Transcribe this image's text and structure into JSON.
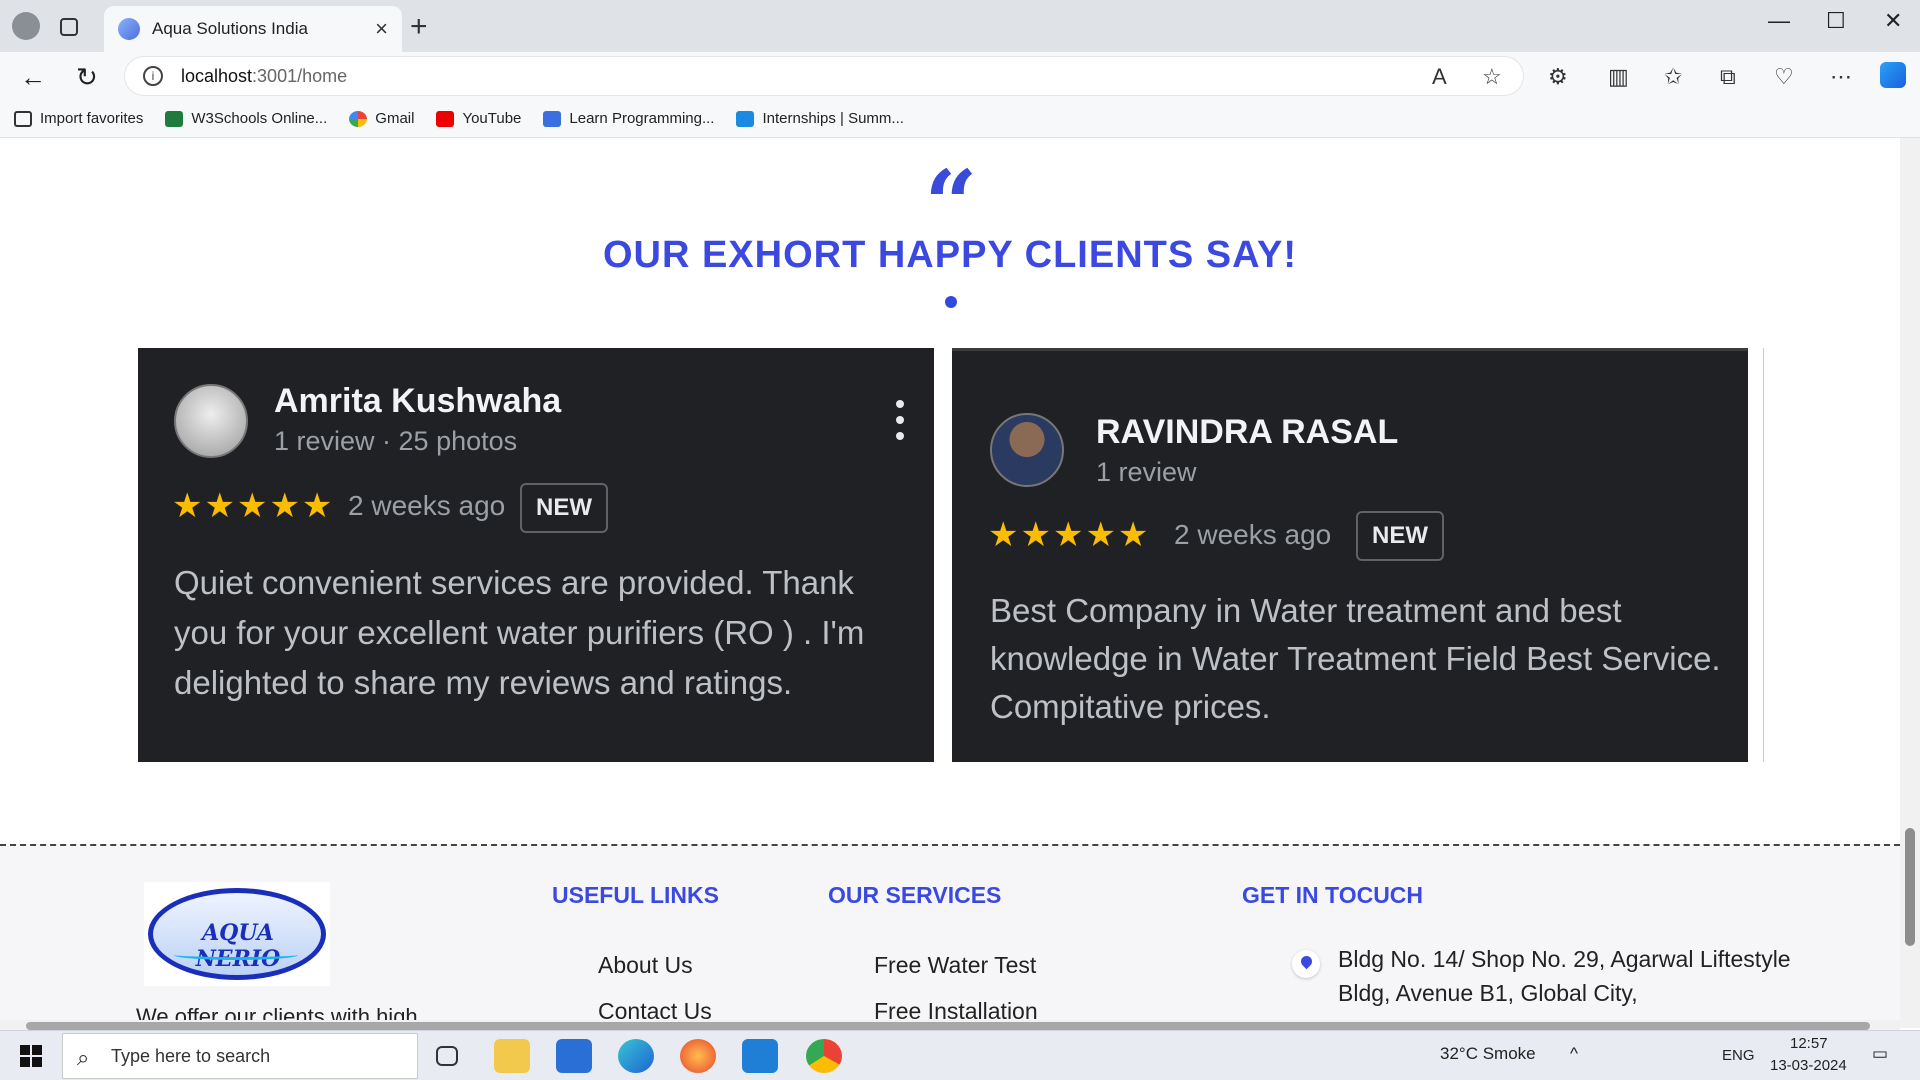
{
  "browser": {
    "tab_title": "Aqua Solutions India",
    "url_host": "localhost",
    "url_path": ":3001/home",
    "bookmarks": [
      "Import favorites",
      "W3Schools Online...",
      "Gmail",
      "YouTube",
      "Learn Programming...",
      "Internships | Summ..."
    ]
  },
  "testimonials": {
    "heading": "OUR EXHORT HAPPY CLIENTS SAY!",
    "quote_mark": "“",
    "reviews": [
      {
        "name": "Amrita Kushwaha",
        "meta": "1 review · 25 photos",
        "stars": "★★★★★",
        "rating": 5,
        "ago": "2 weeks ago",
        "badge": "NEW",
        "text": "Quiet convenient services are provided. Thank you for your excellent water purifiers (RO ) . I'm delighted to share my reviews and ratings."
      },
      {
        "name": "RAVINDRA RASAL",
        "meta": "1 review",
        "stars": "★★★★★",
        "rating": 5,
        "ago": "2 weeks ago",
        "badge": "NEW",
        "text": "Best Company in Water treatment and best knowledge in Water Treatment Field Best Service. Compitative prices."
      }
    ]
  },
  "footer": {
    "logo_text": "AQUA NERIO",
    "description": "We offer our clients with high",
    "useful_links_title": "USEFUL LINKS",
    "useful_links": [
      "About Us",
      "Contact Us"
    ],
    "services_title": "OUR SERVICES",
    "services": [
      "Free Water Test",
      "Free Installation"
    ],
    "contact_title": "GET IN TOCUCH",
    "address": "Bldg No. 14/ Shop No. 29, Agarwal Liftestyle Bldg, Avenue B1, Global City,"
  },
  "taskbar": {
    "search_placeholder": "Type here to search",
    "weather": "32°C  Smoke",
    "lang": "ENG",
    "time": "12:57",
    "date": "13-03-2024"
  },
  "colors": {
    "accent": "#3b49e0",
    "card_bg": "#202124",
    "star": "#fbbc04"
  }
}
